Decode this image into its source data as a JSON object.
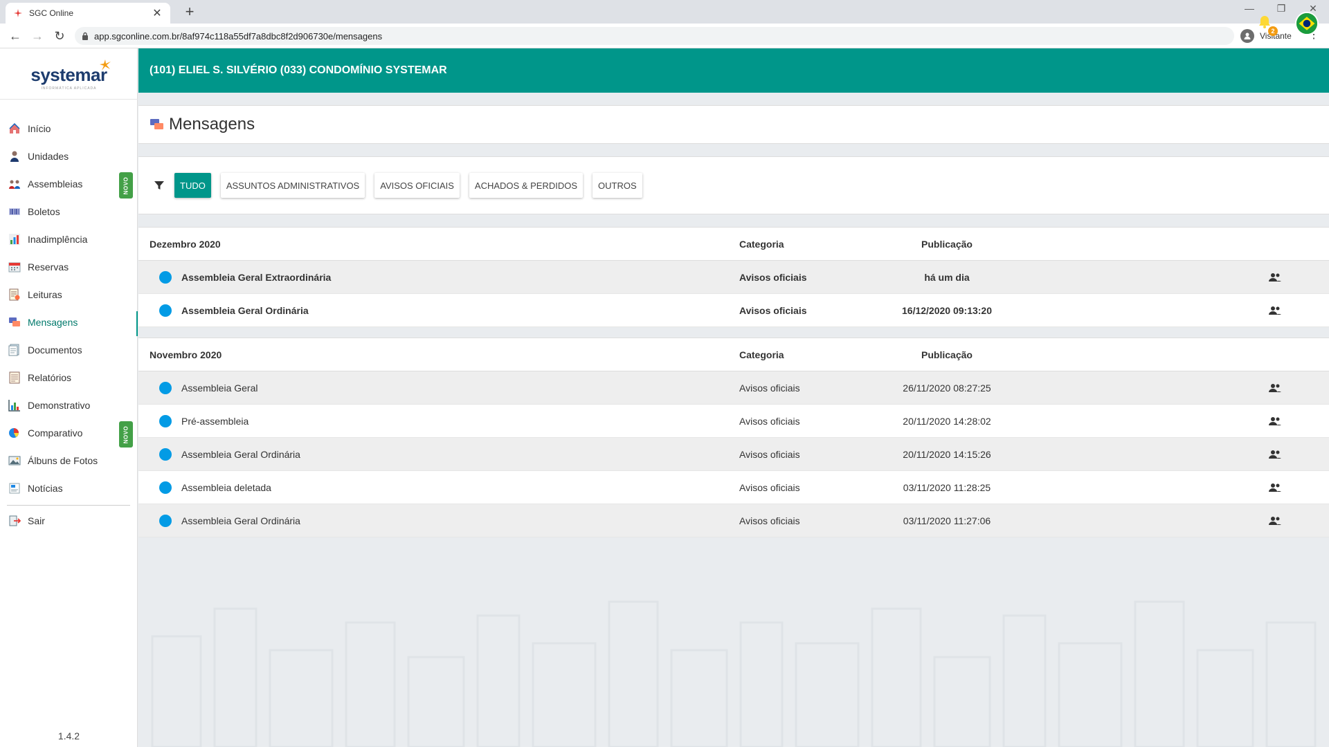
{
  "browser": {
    "tab_title": "SGC Online",
    "url": "app.sgconline.com.br/8af974c118a55df7a8dbc8f2d906730e/mensagens",
    "profile_label": "Visitante"
  },
  "sidebar": {
    "logo": "systemar",
    "logo_sub": "INFORMÁTICA APLICADA",
    "items": [
      {
        "label": "Início",
        "icon": "home-icon"
      },
      {
        "label": "Unidades",
        "icon": "person-icon"
      },
      {
        "label": "Assembleias",
        "icon": "meeting-icon",
        "badge": "NOVO"
      },
      {
        "label": "Boletos",
        "icon": "barcode-icon"
      },
      {
        "label": "Inadimplência",
        "icon": "chart-icon"
      },
      {
        "label": "Reservas",
        "icon": "calendar-icon"
      },
      {
        "label": "Leituras",
        "icon": "meter-icon"
      },
      {
        "label": "Mensagens",
        "icon": "messages-icon",
        "active": true
      },
      {
        "label": "Documentos",
        "icon": "documents-icon"
      },
      {
        "label": "Relatórios",
        "icon": "report-icon"
      },
      {
        "label": "Demonstrativo",
        "icon": "bar-chart-icon"
      },
      {
        "label": "Comparativo",
        "icon": "pie-chart-icon",
        "badge": "NOVO"
      },
      {
        "label": "Álbuns de Fotos",
        "icon": "photo-icon"
      },
      {
        "label": "Notícias",
        "icon": "news-icon"
      }
    ],
    "logout": "Sair",
    "version": "1.4.2"
  },
  "header": {
    "title": "(101) ELIEL S. SILVÉRIO  (033) CONDOMÍNIO SYSTEMAR",
    "notifications": "2"
  },
  "page": {
    "title": "Mensagens"
  },
  "filters": [
    "TUDO",
    "ASSUNTOS ADMINISTRATIVOS",
    "AVISOS OFICIAIS",
    "ACHADOS & PERDIDOS",
    "OUTROS"
  ],
  "columns": {
    "category": "Categoria",
    "published": "Publicação"
  },
  "groups": [
    {
      "month": "Dezembro 2020",
      "rows": [
        {
          "title": "Assembleia Geral Extraordinária",
          "category": "Avisos oficiais",
          "date": "há um dia",
          "unread": true
        },
        {
          "title": "Assembleia Geral Ordinária",
          "category": "Avisos oficiais",
          "date": "16/12/2020 09:13:20",
          "unread": true
        }
      ]
    },
    {
      "month": "Novembro 2020",
      "rows": [
        {
          "title": "Assembleia Geral",
          "category": "Avisos oficiais",
          "date": "26/11/2020 08:27:25",
          "unread": false
        },
        {
          "title": "Pré-assembleia",
          "category": "Avisos oficiais",
          "date": "20/11/2020 14:28:02",
          "unread": false
        },
        {
          "title": "Assembleia Geral Ordinária",
          "category": "Avisos oficiais",
          "date": "20/11/2020 14:15:26",
          "unread": false
        },
        {
          "title": "Assembleia deletada",
          "category": "Avisos oficiais",
          "date": "03/11/2020 11:28:25",
          "unread": false
        },
        {
          "title": "Assembleia Geral Ordinária",
          "category": "Avisos oficiais",
          "date": "03/11/2020 11:27:06",
          "unread": false
        }
      ]
    }
  ],
  "colors": {
    "primary": "#00968a",
    "dot": "#039be5",
    "badge": "#43a047"
  }
}
